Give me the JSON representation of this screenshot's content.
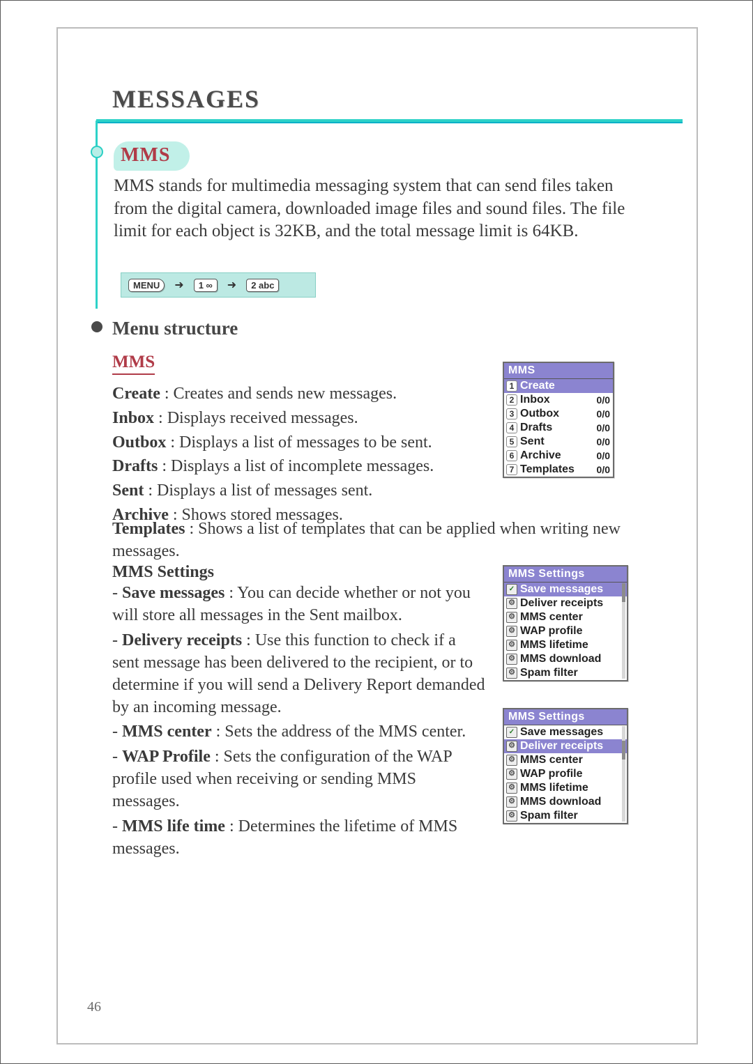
{
  "page_number": "46",
  "title": "MESSAGES",
  "mms_heading": "MMS",
  "mms_paragraph": "MMS stands for multimedia messaging system that can send files taken from the digital camera, downloaded image files and sound files. The file limit for each object is 32KB, and the total message limit is 64KB.",
  "key_sequence": {
    "k1": "MENU",
    "k2": "1 ∞",
    "k3": "2 abc",
    "arrow": "➜"
  },
  "menu_structure_heading": "Menu structure",
  "mms_sub_heading": "MMS",
  "mms_defs": [
    {
      "term": "Create",
      "desc": " : Creates and sends new messages."
    },
    {
      "term": "Inbox",
      "desc": " : Displays received messages."
    },
    {
      "term": "Outbox",
      "desc": " : Displays a list of messages to be sent."
    },
    {
      "term": "Drafts",
      "desc": " : Displays a list of incomplete messages."
    },
    {
      "term": "Sent",
      "desc": " : Displays a list of messages sent."
    },
    {
      "term": "Archive",
      "desc": " : Shows stored messages."
    }
  ],
  "templates_row": {
    "term": "Templates",
    "desc": " : Shows a list of templates that can be applied when writing new messages."
  },
  "mms_settings_heading": "MMS Settings",
  "mms_settings": [
    {
      "term": "Save messages",
      "desc": " : You can decide whether or not you will store all messages in the Sent mailbox."
    },
    {
      "term": "Delivery receipts",
      "desc": " : Use this function to check if a sent message has been delivered to the recipient, or to determine if you will send a Delivery Report demanded by an incoming message."
    },
    {
      "term": "MMS center",
      "desc": " : Sets the address of the MMS center."
    },
    {
      "term": "WAP Profile",
      "desc": " : Sets the configuration of the WAP profile used when receiving or sending MMS messages."
    },
    {
      "term": "MMS life time",
      "desc": " : Determines the lifetime of MMS messages."
    }
  ],
  "shot_mms": {
    "header": "MMS",
    "rows": [
      {
        "n": "1",
        "label": "Create",
        "count": "",
        "sel": true
      },
      {
        "n": "2",
        "label": "Inbox",
        "count": "0/0",
        "sel": false
      },
      {
        "n": "3",
        "label": "Outbox",
        "count": "0/0",
        "sel": false
      },
      {
        "n": "4",
        "label": "Drafts",
        "count": "0/0",
        "sel": false
      },
      {
        "n": "5",
        "label": "Sent",
        "count": "0/0",
        "sel": false
      },
      {
        "n": "6",
        "label": "Archive",
        "count": "0/0",
        "sel": false
      },
      {
        "n": "7",
        "label": "Templates",
        "count": "0/0",
        "sel": false
      }
    ]
  },
  "shot_settings1": {
    "header": "MMS Settings",
    "rows": [
      {
        "icon": "chk",
        "label": "Save messages",
        "sel": true
      },
      {
        "icon": "gear",
        "label": "Deliver receipts",
        "sel": false
      },
      {
        "icon": "gear",
        "label": "MMS center",
        "sel": false
      },
      {
        "icon": "gear",
        "label": "WAP profile",
        "sel": false
      },
      {
        "icon": "gear",
        "label": "MMS lifetime",
        "sel": false
      },
      {
        "icon": "gear",
        "label": "MMS download",
        "sel": false
      },
      {
        "icon": "gear",
        "label": "Spam filter",
        "sel": false
      }
    ]
  },
  "shot_settings2": {
    "header": "MMS Settings",
    "rows": [
      {
        "icon": "chk",
        "label": "Save messages",
        "sel": false
      },
      {
        "icon": "gear",
        "label": "Deliver receipts",
        "sel": true
      },
      {
        "icon": "gear",
        "label": "MMS center",
        "sel": false
      },
      {
        "icon": "gear",
        "label": "WAP profile",
        "sel": false
      },
      {
        "icon": "gear",
        "label": "MMS lifetime",
        "sel": false
      },
      {
        "icon": "gear",
        "label": "MMS download",
        "sel": false
      },
      {
        "icon": "gear",
        "label": "Spam filter",
        "sel": false
      }
    ]
  }
}
